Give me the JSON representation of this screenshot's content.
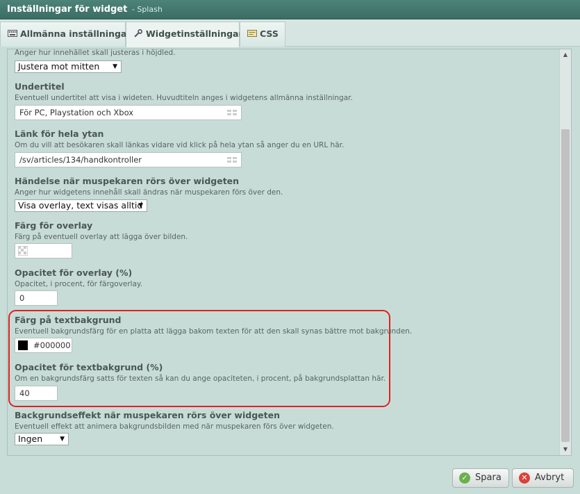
{
  "window": {
    "title": "Inställningar för widget",
    "subtitle": "- Splash"
  },
  "tabs": [
    {
      "label": "Allmänna inställningar",
      "icon": "keyboard-icon"
    },
    {
      "label": "Widgetinställningar",
      "icon": "wrench-icon"
    },
    {
      "label": "CSS",
      "icon": "css-file-icon"
    }
  ],
  "fields": {
    "vertical_align": {
      "desc": "Anger hur innehållet skall justeras i höjdled.",
      "value": "Justera mot mitten"
    },
    "subtitle": {
      "label": "Undertitel",
      "desc": "Eventuell undertitel att visa i wideten. Huvudtiteln anges i widgetens allmänna inställningar.",
      "value": "För PC, Playstation och Xbox"
    },
    "link": {
      "label": "Länk för hela ytan",
      "desc": "Om du vill att besökaren skall länkas vidare vid klick på hela ytan så anger du en URL här.",
      "value": "/sv/articles/134/handkontroller"
    },
    "hover_event": {
      "label": "Händelse när muspekaren rörs över widgeten",
      "desc": "Anger hur widgetens innehåll skall ändras när muspekaren förs över den.",
      "value": "Visa overlay, text visas alltid"
    },
    "overlay_color": {
      "label": "Färg för overlay",
      "desc": "Färg på eventuell overlay att lägga över bilden."
    },
    "overlay_opacity": {
      "label": "Opacitet för overlay (%)",
      "desc": "Opacitet, i procent, för färgoverlay.",
      "value": "0"
    },
    "text_bg_color": {
      "label": "Färg på textbakgrund",
      "desc": "Eventuell bakgrundsfärg för en platta att lägga bakom texten för att den skall synas bättre mot bakgrunden.",
      "value": "#000000"
    },
    "text_bg_opacity": {
      "label": "Opacitet för textbakgrund (%)",
      "desc": "Om en bakgrundsfärg satts för texten så kan du ange opaciteten, i procent, på bakgrundsplattan här.",
      "value": "40"
    },
    "bg_effect": {
      "label": "Backgrundseffekt när muspekaren rörs över widgeten",
      "desc": "Eventuell effekt att animera bakgrundsbilden med när muspekaren förs över widgeten.",
      "value": "Ingen"
    }
  },
  "buttons": {
    "save": "Spara",
    "cancel": "Avbryt"
  },
  "colors": {
    "titlebar": "#3f7369",
    "highlight": "#e02020",
    "save_icon": "#6ab04c",
    "cancel_icon": "#d9433a"
  }
}
